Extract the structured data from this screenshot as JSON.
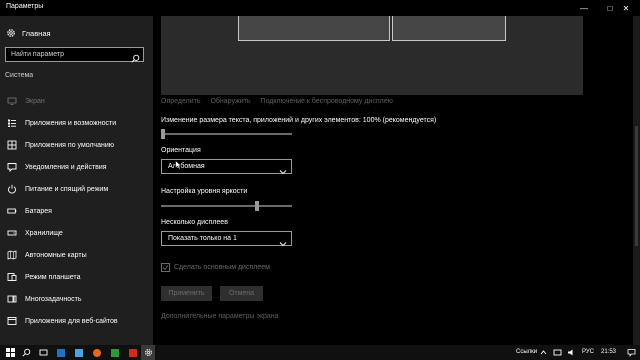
{
  "window": {
    "title": "Параметры",
    "minimize": "—",
    "maximize": "□",
    "close": "✕"
  },
  "sidebar": {
    "home_label": "Главная",
    "search_placeholder": "Найти параметр",
    "section_title": "Система",
    "items": [
      {
        "label": "Экран",
        "icon": "monitor-icon",
        "active": true
      },
      {
        "label": "Приложения и возможности",
        "icon": "apps-list-icon"
      },
      {
        "label": "Приложения по умолчанию",
        "icon": "default-apps-icon"
      },
      {
        "label": "Уведомления и действия",
        "icon": "notifications-icon"
      },
      {
        "label": "Питание и спящий режим",
        "icon": "power-icon"
      },
      {
        "label": "Батарея",
        "icon": "battery-icon"
      },
      {
        "label": "Хранилище",
        "icon": "storage-icon"
      },
      {
        "label": "Автономные карты",
        "icon": "offline-maps-icon"
      },
      {
        "label": "Режим планшета",
        "icon": "tablet-mode-icon"
      },
      {
        "label": "Многозадачность",
        "icon": "multitasking-icon"
      },
      {
        "label": "Приложения для веб-сайтов",
        "icon": "web-apps-icon"
      }
    ]
  },
  "main": {
    "links": {
      "identify": "Определить",
      "detect": "Обнаружить",
      "wireless": "Подключение к беспроводному дисплею"
    },
    "scale_label": "Изменение размера текста, приложений и других элементов: 100% (рекомендуется)",
    "scale_slider_percent": 0,
    "orientation_label": "Ориентация",
    "orientation_value": "Альбомная",
    "brightness_label": "Настройка уровня яркости",
    "brightness_slider_percent": 74,
    "multi_display_label": "Несколько дисплеев",
    "multi_display_value": "Показать только на 1",
    "main_display_checkbox": "Сделать основным дисплеем",
    "apply_button": "Применить",
    "cancel_button": "Отмена",
    "advanced_link": "Дополнительные параметры экрана"
  },
  "taskbar": {
    "links_label": "Ссылки",
    "language": "РУС",
    "time": "21:53"
  },
  "colors": {
    "background": "#000000",
    "sidebar": "#1f1f1f",
    "preview": "#2b2b2b",
    "disabled_text": "#6a6a6a"
  }
}
